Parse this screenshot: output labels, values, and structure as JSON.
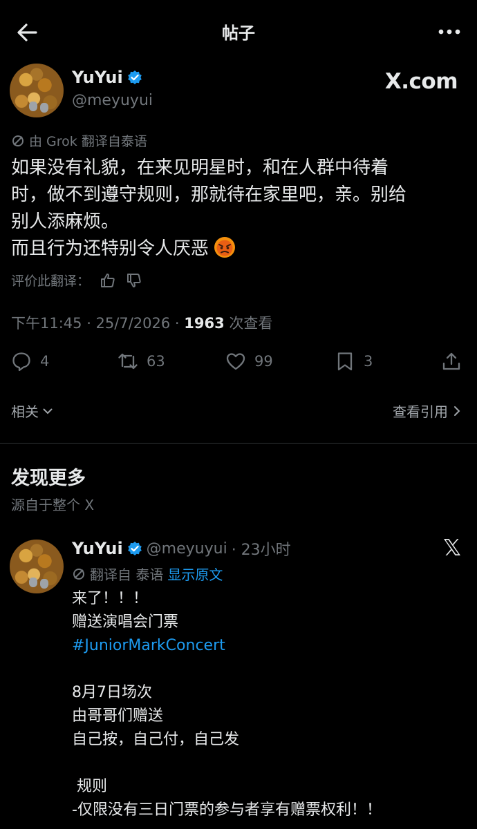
{
  "header": {
    "title": "帖子"
  },
  "post": {
    "author_name": "YuYui",
    "author_handle": "@meyuyui",
    "watermark": "X.com",
    "translated_note": "由 Grok 翻译自泰语",
    "body_lines": [
      "如果没有礼貌，在来见明星时，和在人群中待着",
      "时，做不到遵守规则，那就待在家里吧，亲。别给",
      "别人添麻烦。",
      "而且行为还特别令人厌恶"
    ],
    "emoji": "angry-face",
    "rate_label": "评价此翻译：",
    "time": "下午11:45 · 25/7/2026 · ",
    "views_count": "1963",
    "views_label": " 次查看",
    "actions": {
      "replies": "4",
      "reposts": "63",
      "likes": "99",
      "bookmarks": "3"
    },
    "related_label": "相关",
    "quotes_label": "查看引用"
  },
  "discover": {
    "title": "发现更多",
    "subtitle": "源自于整个 X"
  },
  "post2": {
    "author_name": "YuYui",
    "author_handle": "@meyuyui",
    "time": "· 23小时",
    "translated_prefix": "翻译自 泰语",
    "show_original": "显示原文",
    "lines": [
      "来了！！！",
      "赠送演唱会门票",
      "#JuniorMarkConcert",
      "",
      "8月7日场次",
      "由哥哥们赠送",
      "自己按，自己付，自己发",
      "",
      " 规则",
      "-仅限没有三日门票的参与者享有赠票权利！！"
    ]
  },
  "colors": {
    "background": "#000000",
    "text": "#e7e9ea",
    "muted": "#71767b",
    "accent": "#1d9bf0"
  }
}
